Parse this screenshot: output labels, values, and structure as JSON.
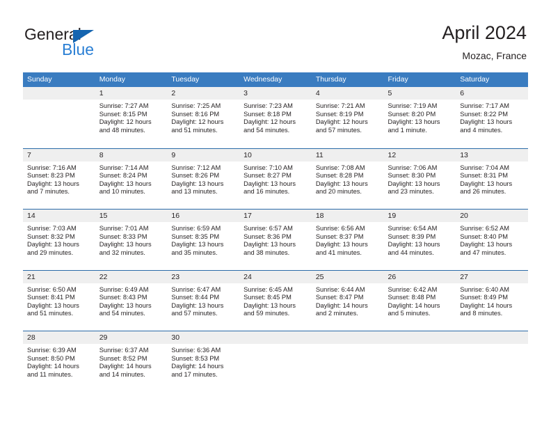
{
  "brand": {
    "name_part1": "General",
    "name_part2": "Blue"
  },
  "header": {
    "title": "April 2024",
    "location": "Mozac, France"
  },
  "colors": {
    "header_blue": "#3a7cc0",
    "separator_blue": "#2a6aa8",
    "band_gray": "#efefef",
    "brand_blue": "#2a7fd4",
    "brand_triangle": "#1565b0",
    "text": "#231f20"
  },
  "weekdays": [
    "Sunday",
    "Monday",
    "Tuesday",
    "Wednesday",
    "Thursday",
    "Friday",
    "Saturday"
  ],
  "weeks": [
    [
      {
        "day": "",
        "lines": []
      },
      {
        "day": "1",
        "lines": [
          "Sunrise: 7:27 AM",
          "Sunset: 8:15 PM",
          "Daylight: 12 hours",
          "and 48 minutes."
        ]
      },
      {
        "day": "2",
        "lines": [
          "Sunrise: 7:25 AM",
          "Sunset: 8:16 PM",
          "Daylight: 12 hours",
          "and 51 minutes."
        ]
      },
      {
        "day": "3",
        "lines": [
          "Sunrise: 7:23 AM",
          "Sunset: 8:18 PM",
          "Daylight: 12 hours",
          "and 54 minutes."
        ]
      },
      {
        "day": "4",
        "lines": [
          "Sunrise: 7:21 AM",
          "Sunset: 8:19 PM",
          "Daylight: 12 hours",
          "and 57 minutes."
        ]
      },
      {
        "day": "5",
        "lines": [
          "Sunrise: 7:19 AM",
          "Sunset: 8:20 PM",
          "Daylight: 13 hours",
          "and 1 minute."
        ]
      },
      {
        "day": "6",
        "lines": [
          "Sunrise: 7:17 AM",
          "Sunset: 8:22 PM",
          "Daylight: 13 hours",
          "and 4 minutes."
        ]
      }
    ],
    [
      {
        "day": "7",
        "lines": [
          "Sunrise: 7:16 AM",
          "Sunset: 8:23 PM",
          "Daylight: 13 hours",
          "and 7 minutes."
        ]
      },
      {
        "day": "8",
        "lines": [
          "Sunrise: 7:14 AM",
          "Sunset: 8:24 PM",
          "Daylight: 13 hours",
          "and 10 minutes."
        ]
      },
      {
        "day": "9",
        "lines": [
          "Sunrise: 7:12 AM",
          "Sunset: 8:26 PM",
          "Daylight: 13 hours",
          "and 13 minutes."
        ]
      },
      {
        "day": "10",
        "lines": [
          "Sunrise: 7:10 AM",
          "Sunset: 8:27 PM",
          "Daylight: 13 hours",
          "and 16 minutes."
        ]
      },
      {
        "day": "11",
        "lines": [
          "Sunrise: 7:08 AM",
          "Sunset: 8:28 PM",
          "Daylight: 13 hours",
          "and 20 minutes."
        ]
      },
      {
        "day": "12",
        "lines": [
          "Sunrise: 7:06 AM",
          "Sunset: 8:30 PM",
          "Daylight: 13 hours",
          "and 23 minutes."
        ]
      },
      {
        "day": "13",
        "lines": [
          "Sunrise: 7:04 AM",
          "Sunset: 8:31 PM",
          "Daylight: 13 hours",
          "and 26 minutes."
        ]
      }
    ],
    [
      {
        "day": "14",
        "lines": [
          "Sunrise: 7:03 AM",
          "Sunset: 8:32 PM",
          "Daylight: 13 hours",
          "and 29 minutes."
        ]
      },
      {
        "day": "15",
        "lines": [
          "Sunrise: 7:01 AM",
          "Sunset: 8:33 PM",
          "Daylight: 13 hours",
          "and 32 minutes."
        ]
      },
      {
        "day": "16",
        "lines": [
          "Sunrise: 6:59 AM",
          "Sunset: 8:35 PM",
          "Daylight: 13 hours",
          "and 35 minutes."
        ]
      },
      {
        "day": "17",
        "lines": [
          "Sunrise: 6:57 AM",
          "Sunset: 8:36 PM",
          "Daylight: 13 hours",
          "and 38 minutes."
        ]
      },
      {
        "day": "18",
        "lines": [
          "Sunrise: 6:56 AM",
          "Sunset: 8:37 PM",
          "Daylight: 13 hours",
          "and 41 minutes."
        ]
      },
      {
        "day": "19",
        "lines": [
          "Sunrise: 6:54 AM",
          "Sunset: 8:39 PM",
          "Daylight: 13 hours",
          "and 44 minutes."
        ]
      },
      {
        "day": "20",
        "lines": [
          "Sunrise: 6:52 AM",
          "Sunset: 8:40 PM",
          "Daylight: 13 hours",
          "and 47 minutes."
        ]
      }
    ],
    [
      {
        "day": "21",
        "lines": [
          "Sunrise: 6:50 AM",
          "Sunset: 8:41 PM",
          "Daylight: 13 hours",
          "and 51 minutes."
        ]
      },
      {
        "day": "22",
        "lines": [
          "Sunrise: 6:49 AM",
          "Sunset: 8:43 PM",
          "Daylight: 13 hours",
          "and 54 minutes."
        ]
      },
      {
        "day": "23",
        "lines": [
          "Sunrise: 6:47 AM",
          "Sunset: 8:44 PM",
          "Daylight: 13 hours",
          "and 57 minutes."
        ]
      },
      {
        "day": "24",
        "lines": [
          "Sunrise: 6:45 AM",
          "Sunset: 8:45 PM",
          "Daylight: 13 hours",
          "and 59 minutes."
        ]
      },
      {
        "day": "25",
        "lines": [
          "Sunrise: 6:44 AM",
          "Sunset: 8:47 PM",
          "Daylight: 14 hours",
          "and 2 minutes."
        ]
      },
      {
        "day": "26",
        "lines": [
          "Sunrise: 6:42 AM",
          "Sunset: 8:48 PM",
          "Daylight: 14 hours",
          "and 5 minutes."
        ]
      },
      {
        "day": "27",
        "lines": [
          "Sunrise: 6:40 AM",
          "Sunset: 8:49 PM",
          "Daylight: 14 hours",
          "and 8 minutes."
        ]
      }
    ],
    [
      {
        "day": "28",
        "lines": [
          "Sunrise: 6:39 AM",
          "Sunset: 8:50 PM",
          "Daylight: 14 hours",
          "and 11 minutes."
        ]
      },
      {
        "day": "29",
        "lines": [
          "Sunrise: 6:37 AM",
          "Sunset: 8:52 PM",
          "Daylight: 14 hours",
          "and 14 minutes."
        ]
      },
      {
        "day": "30",
        "lines": [
          "Sunrise: 6:36 AM",
          "Sunset: 8:53 PM",
          "Daylight: 14 hours",
          "and 17 minutes."
        ]
      },
      {
        "day": "",
        "lines": []
      },
      {
        "day": "",
        "lines": []
      },
      {
        "day": "",
        "lines": []
      },
      {
        "day": "",
        "lines": []
      }
    ]
  ]
}
